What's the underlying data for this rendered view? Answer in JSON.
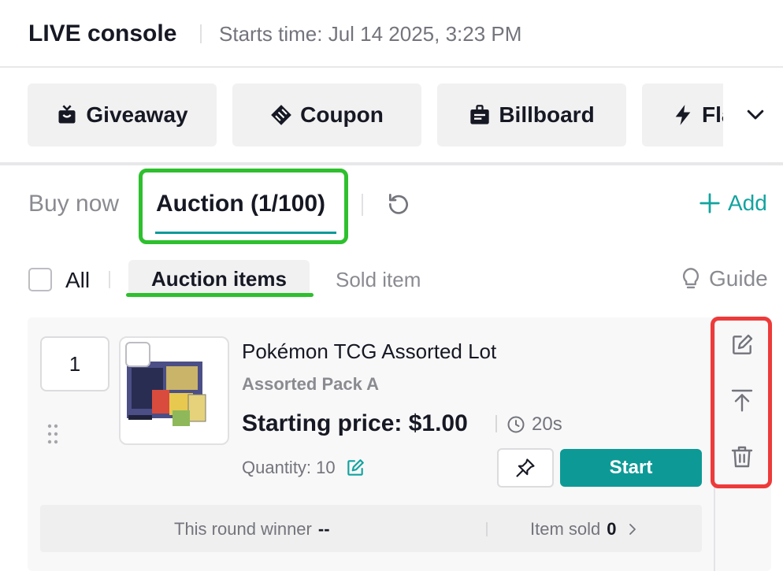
{
  "header": {
    "title": "LIVE console",
    "start_time": "Starts time: Jul 14 2025, 3:23 PM"
  },
  "tools": {
    "items": [
      {
        "label": "Giveaway",
        "icon": "gift-icon"
      },
      {
        "label": "Coupon",
        "icon": "ticket-icon"
      },
      {
        "label": "Billboard",
        "icon": "billboard-icon"
      },
      {
        "label": "Fla",
        "icon": "flash-icon"
      }
    ],
    "expand_icon": "chevron-down-icon"
  },
  "tabs": {
    "buy_now": "Buy now",
    "auction": "Auction (1/100)",
    "refresh_icon": "refresh-icon",
    "add_label": "Add"
  },
  "subtabs": {
    "all": "All",
    "auction_items": "Auction items",
    "sold_item": "Sold item",
    "guide": "Guide"
  },
  "item": {
    "index": "1",
    "name": "Pokémon TCG Assorted Lot",
    "subtitle": "Assorted Pack A",
    "price": "Starting price: $1.00",
    "duration": "20s",
    "quantity": "Quantity: 10",
    "start_label": "Start",
    "winner_label": "This round winner",
    "winner_value": "--",
    "sold_label": "Item sold",
    "sold_value": "0",
    "actions": [
      "edit-icon",
      "move-to-top-icon",
      "trash-icon"
    ]
  },
  "colors": {
    "accent": "#0d9a96",
    "add_text": "#13a3a0",
    "highlight_green": "#2ec02e",
    "highlight_red": "#ee3a3a"
  }
}
